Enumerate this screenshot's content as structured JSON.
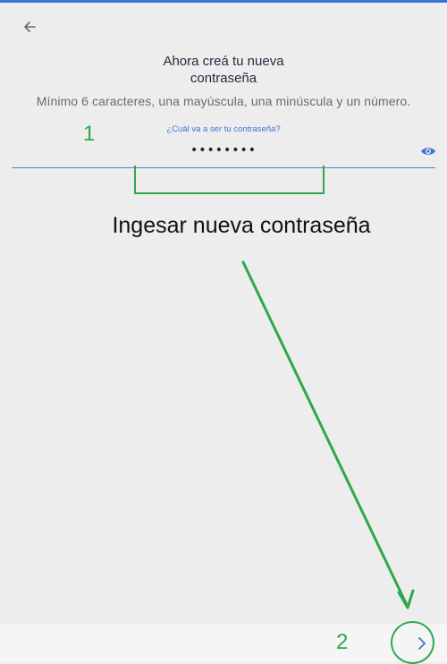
{
  "header": {
    "back_icon": "arrow-left-icon",
    "title_line1": "Ahora creá tu nueva",
    "title_line2": "contraseña"
  },
  "instructions": "Mínimo 6 caracteres, una mayúscula, una minúscula y un número.",
  "password_field": {
    "label": "¿Cuál va a ser tu contraseña?",
    "value": "••••••••",
    "eye_icon": "eye-icon"
  },
  "annotations": {
    "step1": "1",
    "step1_text": "Ingesar nueva contraseña",
    "step2": "2",
    "color": "#2fa84a"
  },
  "footer": {
    "next_icon": "chevron-right-icon"
  },
  "colors": {
    "accent": "#3d74d0",
    "background": "#ededed"
  }
}
